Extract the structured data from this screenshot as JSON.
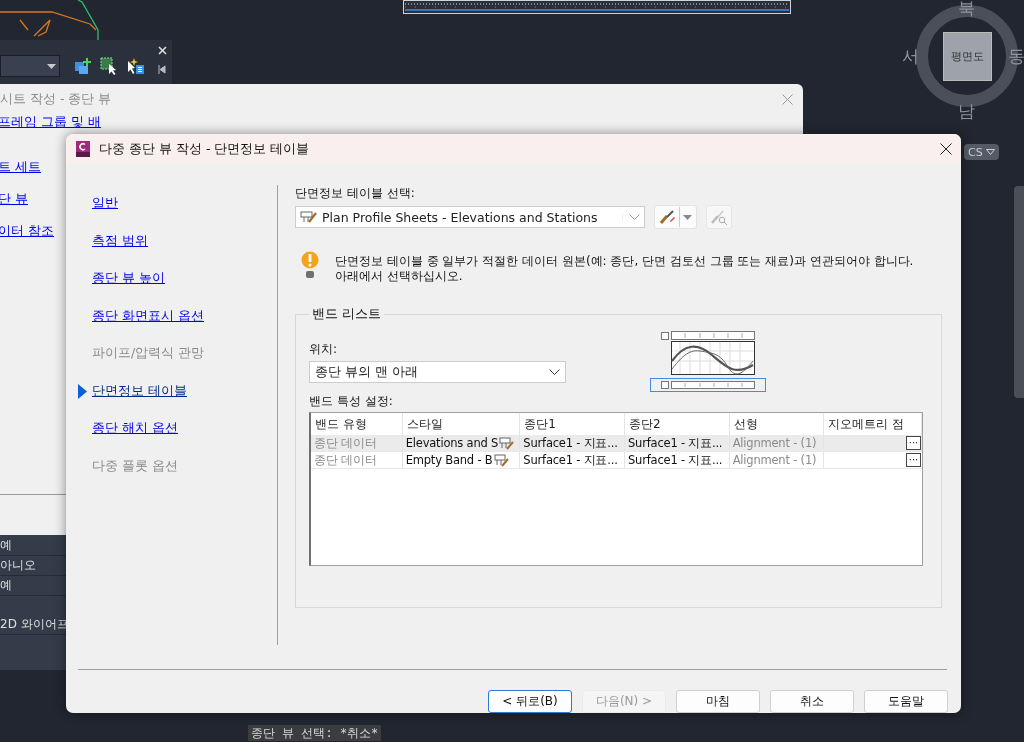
{
  "background_dialog": {
    "title": "시트 작성 - 종단 뷰",
    "links": [
      "프레임 그룹 및 배",
      "트 세트",
      "단 뷰",
      "이터 참조"
    ]
  },
  "properties": {
    "values": [
      "예",
      "아니오",
      "예",
      "2D 와이어프"
    ]
  },
  "view_cube": {
    "face": "평면도",
    "north": "북",
    "west": "서",
    "east": "동",
    "south": "남",
    "ucs": "CS"
  },
  "command_line": [
    "종단 뷰 선택: *취소*"
  ],
  "dialog": {
    "title": "다중 종단 뷰 작성 - 단면정보 테이블",
    "nav": [
      {
        "label": "일반",
        "selected": false,
        "disabled": false
      },
      {
        "label": "측점 범위",
        "selected": false,
        "disabled": false
      },
      {
        "label": "종단 뷰 높이",
        "selected": false,
        "disabled": false
      },
      {
        "label": "종단 화면표시 옵션",
        "selected": false,
        "disabled": false
      },
      {
        "label": "파이프/압력식 관망",
        "selected": false,
        "disabled": true
      },
      {
        "label": "단면정보 테이블",
        "selected": true,
        "disabled": false
      },
      {
        "label": "종단 해치 옵션",
        "selected": false,
        "disabled": false
      },
      {
        "label": "다중 플롯 옵션",
        "selected": false,
        "disabled": true
      }
    ],
    "table_select": {
      "label": "단면정보 테이블 선택:",
      "value": "Plan Profile Sheets - Elevations and Stations"
    },
    "warning": "단면정보 테이블 중 일부가 적절한 데이터 원본(예: 종단, 단면 검토선 그룹 또는 재료)과 연관되어야 합니다. 아래에서 선택하십시오.",
    "band_list": {
      "title": "밴드 리스트",
      "location_label": "위치:",
      "location": "종단 뷰의 맨 아래",
      "settings_label": "밴드 특성 설정:",
      "columns": [
        "밴드 유형",
        "스타일",
        "종단1",
        "종단2",
        "선형",
        "지오메트리 점"
      ],
      "rows": [
        {
          "selected": true,
          "cells": [
            "종단 데이터",
            "Elevations and S",
            "Surface1 - 지표...",
            "Surface1 - 지표...",
            "Alignment - (1)"
          ],
          "button": "···"
        },
        {
          "selected": false,
          "cells": [
            "종단 데이터",
            "Empty Band - B",
            "Surface1 - 지표...",
            "Surface1 - 지표...",
            "Alignment - (1)"
          ],
          "button": "···"
        }
      ]
    },
    "buttons": [
      {
        "label": "< 뒤로(B)",
        "disabled": false,
        "focused": true
      },
      {
        "label": "다음(N) >",
        "disabled": true,
        "focused": false
      },
      {
        "label": "마침",
        "disabled": false,
        "focused": false
      },
      {
        "label": "취소",
        "disabled": false,
        "focused": false
      },
      {
        "label": "도움말",
        "disabled": false,
        "focused": false
      }
    ]
  }
}
